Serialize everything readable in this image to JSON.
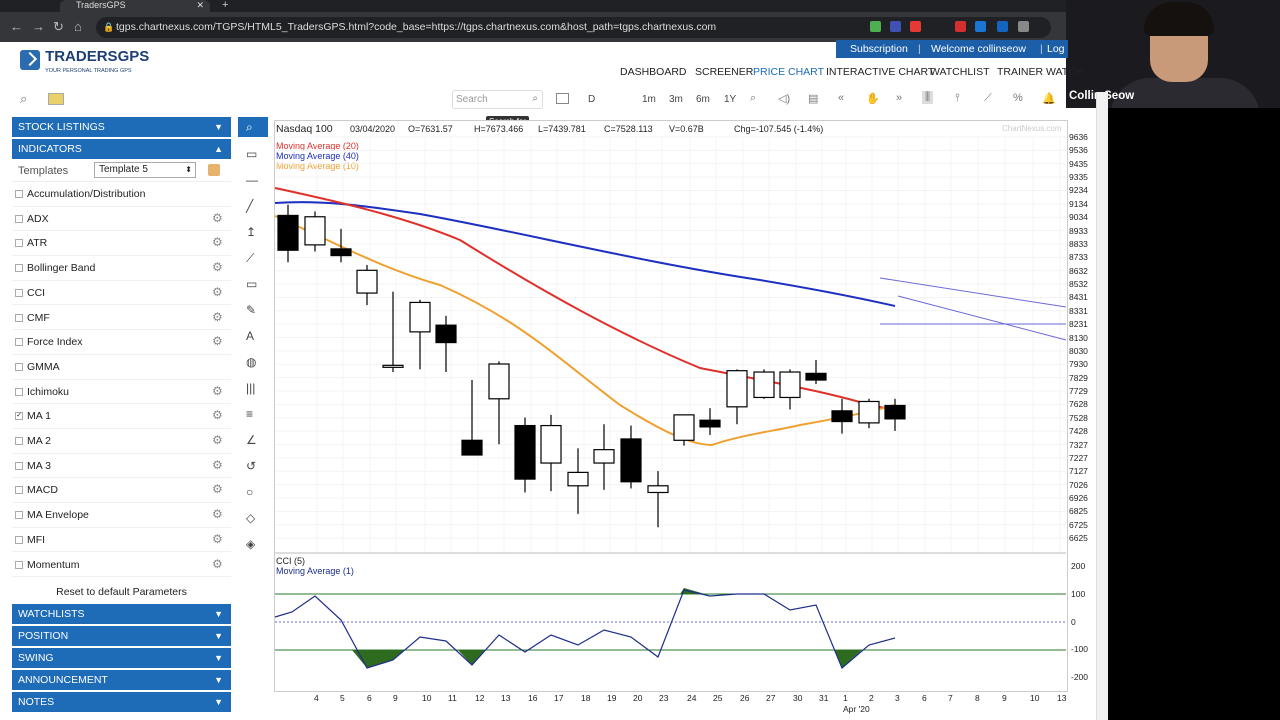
{
  "browser": {
    "tab_title": "TradersGPS",
    "tab_close": "✕",
    "new_tab": "+",
    "url": "tgps.chartnexus.com/TGPS/HTML5_TradersGPS.html?code_base=https://tgps.chartnexus.com&host_path=tgps.chartnexus.com"
  },
  "webcam": {
    "name": "Collin Seow"
  },
  "header": {
    "subscription": "Subscription",
    "divider1": "|",
    "welcome": "Welcome collinseow",
    "divider2": "|",
    "logout": "Log",
    "logo_text": "TRADERSGPS",
    "logo_sub": "YOUR PERSONAL TRADING GPS"
  },
  "nav": {
    "items": [
      "DASHBOARD",
      "SCREENER",
      "PRICE CHART",
      "INTERACTIVE CHART",
      "WATCHLIST",
      "TRAINER WATCH"
    ],
    "active_index": 2,
    "active_color": "#1e6bb8"
  },
  "toolbar": {
    "search_placeholder": "Search",
    "search_tooltip": "Search for",
    "periods": [
      "D",
      "1m",
      "3m",
      "6m",
      "1Y"
    ]
  },
  "sidebar": {
    "stock_listings": "STOCK LISTINGS",
    "indicators": "INDICATORS",
    "templates_label": "Templates",
    "template_selected": "Template 5",
    "indicator_items": [
      {
        "label": "Accumulation/Distribution",
        "checked": false,
        "gear": false
      },
      {
        "label": "ADX",
        "checked": false,
        "gear": true
      },
      {
        "label": "ATR",
        "checked": false,
        "gear": true
      },
      {
        "label": "Bollinger Band",
        "checked": false,
        "gear": true
      },
      {
        "label": "CCI",
        "checked": false,
        "gear": true
      },
      {
        "label": "CMF",
        "checked": false,
        "gear": true
      },
      {
        "label": "Force Index",
        "checked": false,
        "gear": true
      },
      {
        "label": "GMMA",
        "checked": false,
        "gear": false
      },
      {
        "label": "Ichimoku",
        "checked": false,
        "gear": true
      },
      {
        "label": "MA 1",
        "checked": true,
        "gear": true
      },
      {
        "label": "MA 2",
        "checked": false,
        "gear": true
      },
      {
        "label": "MA 3",
        "checked": false,
        "gear": true
      },
      {
        "label": "MACD",
        "checked": false,
        "gear": true
      },
      {
        "label": "MA Envelope",
        "checked": false,
        "gear": true
      },
      {
        "label": "MFI",
        "checked": false,
        "gear": true
      },
      {
        "label": "Momentum",
        "checked": false,
        "gear": true
      }
    ],
    "reset": "Reset to default Parameters",
    "sections": [
      "WATCHLISTS",
      "POSITION",
      "SWING",
      "ANNOUNCEMENT",
      "NOTES"
    ]
  },
  "chart": {
    "symbol": "Nasdaq 100",
    "date": "03/04/2020",
    "open": "O=7631.57",
    "high": "H=7673.466",
    "low": "L=7439.781",
    "close": "C=7528.113",
    "volume": "V=0.67B",
    "change": "Chg=-107.545 (-1.4%)",
    "watermark": "ChartNexus.com",
    "legend": [
      {
        "label": "Moving Average (20)",
        "color": "#e0302a"
      },
      {
        "label": "Moving Average (40)",
        "color": "#1c2fc0"
      },
      {
        "label": "Moving Average (10)",
        "color": "#f0a030"
      }
    ],
    "cci_title": "CCI (5)",
    "cci_ma": "Moving Average (1)",
    "x_labels": [
      "4",
      "5",
      "6",
      "9",
      "10",
      "11",
      "12",
      "13",
      "16",
      "17",
      "18",
      "19",
      "20",
      "23",
      "24",
      "25",
      "26",
      "27",
      "30",
      "31",
      "1",
      "2",
      "3",
      "6",
      "7",
      "8",
      "9",
      "10",
      "13"
    ],
    "x_month": "Apr '20"
  },
  "chart_data": {
    "type": "candlestick",
    "y_ticks": [
      "9636",
      "9536",
      "9435",
      "9335",
      "9234",
      "9134",
      "9034",
      "8933",
      "8833",
      "8733",
      "8632",
      "8532",
      "8431",
      "8331",
      "8231",
      "8130",
      "8030",
      "7930",
      "7829",
      "7729",
      "7628",
      "7528",
      "7428",
      "7327",
      "7227",
      "7127",
      "7026",
      "6926",
      "6825",
      "6725",
      "6625"
    ],
    "cci_ticks": [
      "200",
      "100",
      "0",
      "-100",
      "-200"
    ],
    "candles": [
      {
        "o": 9050,
        "h": 9130,
        "l": 8700,
        "c": 8790,
        "bull": false
      },
      {
        "o": 8830,
        "h": 9080,
        "l": 8780,
        "c": 9040,
        "bull": true
      },
      {
        "o": 8800,
        "h": 8950,
        "l": 8700,
        "c": 8750,
        "bull": false
      },
      {
        "o": 8470,
        "h": 8680,
        "l": 8380,
        "c": 8640,
        "bull": true
      },
      {
        "o": 7920,
        "h": 8480,
        "l": 7880,
        "c": 7930,
        "bull": true
      },
      {
        "o": 8180,
        "h": 8420,
        "l": 7900,
        "c": 8400,
        "bull": true
      },
      {
        "o": 8230,
        "h": 8300,
        "l": 7880,
        "c": 8100,
        "bull": false
      },
      {
        "o": 7370,
        "h": 7820,
        "l": 7370,
        "c": 7260,
        "bull": false
      },
      {
        "o": 7680,
        "h": 7960,
        "l": 7340,
        "c": 7940,
        "bull": true
      },
      {
        "o": 7480,
        "h": 7540,
        "l": 6980,
        "c": 7080,
        "bull": false
      },
      {
        "o": 7200,
        "h": 7560,
        "l": 6990,
        "c": 7480,
        "bull": true
      },
      {
        "o": 7030,
        "h": 7310,
        "l": 6820,
        "c": 7130,
        "bull": true
      },
      {
        "o": 7200,
        "h": 7490,
        "l": 7000,
        "c": 7300,
        "bull": true
      },
      {
        "o": 7380,
        "h": 7480,
        "l": 7010,
        "c": 7060,
        "bull": false
      },
      {
        "o": 6980,
        "h": 7140,
        "l": 6720,
        "c": 7030,
        "bull": true
      },
      {
        "o": 7370,
        "h": 7560,
        "l": 7330,
        "c": 7560,
        "bull": true
      },
      {
        "o": 7520,
        "h": 7610,
        "l": 7410,
        "c": 7470,
        "bull": false
      },
      {
        "o": 7620,
        "h": 7900,
        "l": 7490,
        "c": 7890,
        "bull": true
      },
      {
        "o": 7690,
        "h": 7900,
        "l": 7680,
        "c": 7880,
        "bull": true
      },
      {
        "o": 7880,
        "h": 7900,
        "l": 7600,
        "c": 7690,
        "bull": true
      },
      {
        "o": 7870,
        "h": 7970,
        "l": 7790,
        "c": 7820,
        "bull": false
      },
      {
        "o": 7590,
        "h": 7680,
        "l": 7420,
        "c": 7510,
        "bull": false
      },
      {
        "o": 7500,
        "h": 7680,
        "l": 7460,
        "c": 7660,
        "bull": true
      },
      {
        "o": 7630,
        "h": 7680,
        "l": 7440,
        "c": 7530,
        "bull": false
      }
    ]
  }
}
